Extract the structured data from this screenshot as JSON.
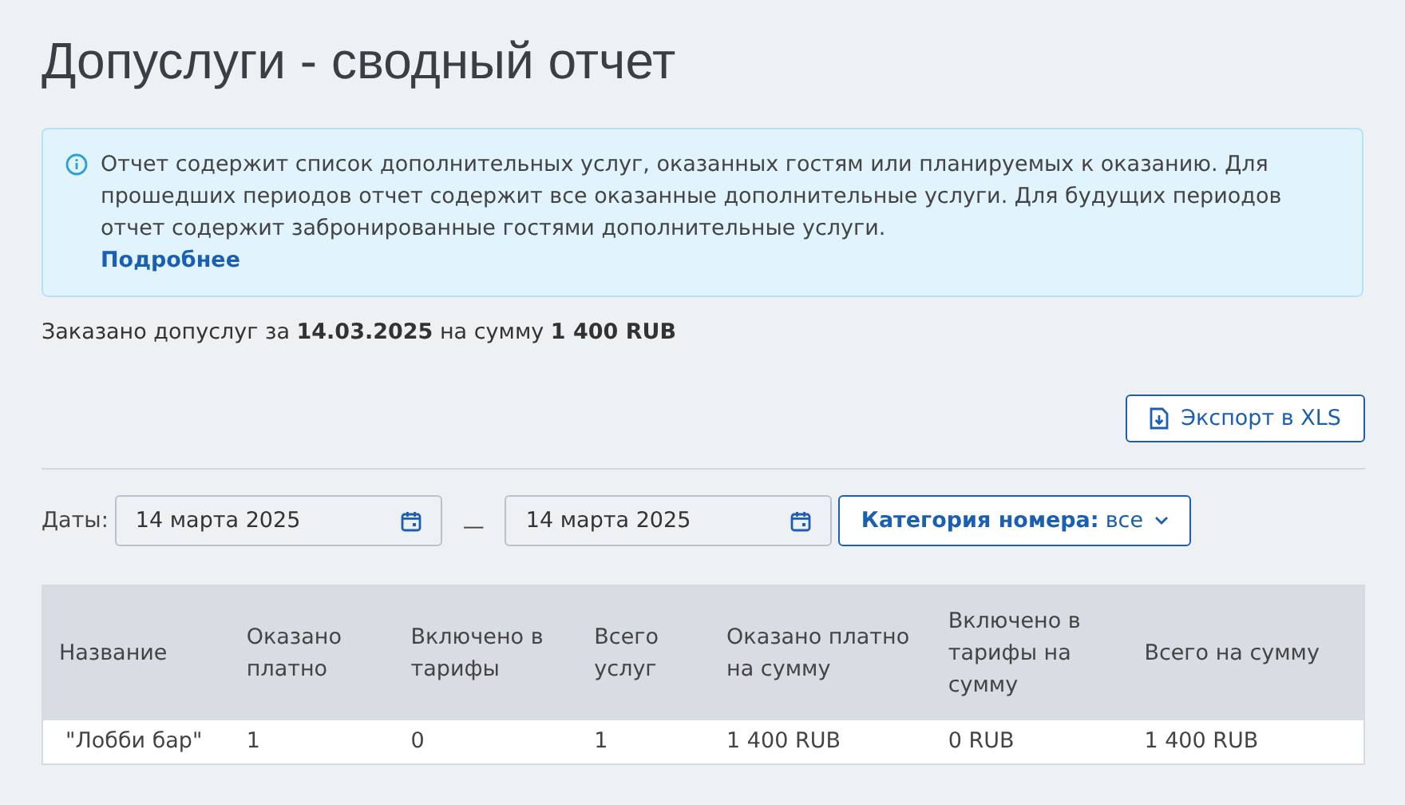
{
  "title": "Допуслуги - сводный отчет",
  "info": {
    "text": "Отчет содержит список дополнительных услуг, оказанных гостям или планируемых к оказанию. Для прошедших периодов отчет содержит все оказанные дополнительные услуги. Для будущих периодов отчет содержит забронированные гостями дополнительные услуги.",
    "link": "Подробнее"
  },
  "summary": "Заказано допуслуг за **14.03.2025** на сумму **1 400 RUB**",
  "export_button": "Экспорт в XLS",
  "filters": {
    "dates_label": "Даты:",
    "date_from": "14 марта 2025",
    "separator": "—",
    "date_to": "14 марта 2025",
    "category_label": "Категория номера:",
    "category_value": "все"
  },
  "table": {
    "columns": [
      "Название",
      "Оказано платно",
      "Включено в тарифы",
      "Всего услуг",
      "Оказано платно на сумму",
      "Включено в тарифы на сумму",
      "Всего на сумму"
    ],
    "rows": [
      [
        "\"Лобби бар\"",
        "1",
        "0",
        "1",
        "1 400 RUB",
        "0 RUB",
        "1 400 RUB"
      ]
    ]
  }
}
